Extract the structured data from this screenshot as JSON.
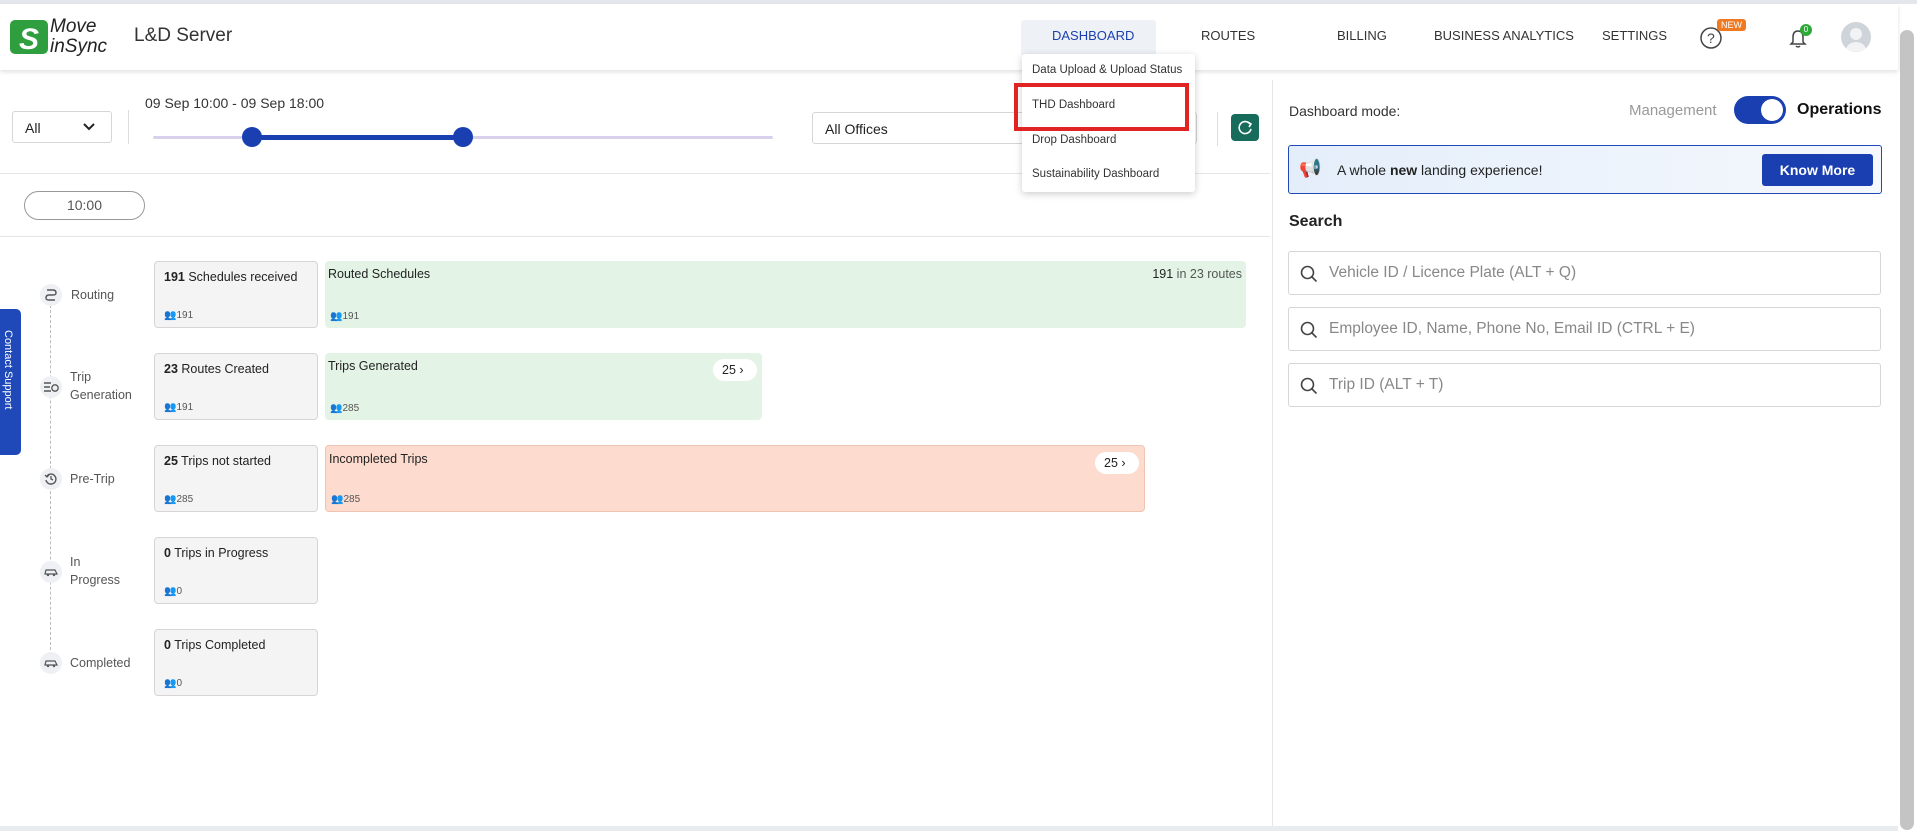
{
  "header": {
    "logo_line1": "Move",
    "logo_line2": "inSync",
    "app_title": "L&D Server",
    "nav": [
      "DASHBOARD",
      "ROUTES",
      "BILLING",
      "BUSINESS ANALYTICS",
      "SETTINGS"
    ],
    "new_badge": "NEW",
    "notification_count": "0"
  },
  "dropdown": {
    "items": [
      "Data Upload & Upload Status",
      "THD Dashboard",
      "Drop Dashboard",
      "Sustainability Dashboard"
    ]
  },
  "filters": {
    "shift_select": "All",
    "time_range": "09 Sep 10:00 - 09 Sep 18:00",
    "slider_start": 0.16,
    "slider_end": 0.5,
    "offices_select": "All Offices",
    "time_pill": "10:00"
  },
  "contact_support": "Contact Support",
  "stages": [
    {
      "label": "Routing",
      "icon": "routing-icon"
    },
    {
      "label": "Trip Generation",
      "icon": "trip-generation-icon"
    },
    {
      "label": "Pre-Trip",
      "icon": "pre-trip-icon"
    },
    {
      "label": "In Progress",
      "icon": "in-progress-icon"
    },
    {
      "label": "Completed",
      "icon": "completed-icon"
    }
  ],
  "cards": [
    {
      "num": "191",
      "text": "Schedules received",
      "count": "191"
    },
    {
      "num": "23",
      "text": "Routes Created",
      "count": "191"
    },
    {
      "num": "25",
      "text": "Trips not started",
      "count": "285"
    },
    {
      "num": "0",
      "text": "Trips in Progress",
      "count": "0"
    },
    {
      "num": "0",
      "text": "Trips Completed",
      "count": "0"
    }
  ],
  "wide_cards": [
    {
      "title": "Routed Schedules",
      "count": "191",
      "right_num": "191",
      "right_text": "in 23 routes"
    },
    {
      "title": "Trips Generated",
      "count": "285",
      "pill": "25"
    },
    {
      "title": "Incompleted Trips",
      "count": "285",
      "pill": "25"
    }
  ],
  "right_panel": {
    "mode_label": "Dashboard mode:",
    "mode_management": "Management",
    "mode_operations": "Operations",
    "banner_pre": "A whole ",
    "banner_bold": "new",
    "banner_post": " landing experience!",
    "know_more": "Know More",
    "search_title": "Search",
    "search_vehicle": "Vehicle ID / Licence Plate (ALT + Q)",
    "search_employee": "Employee ID, Name, Phone No, Email ID (CTRL + E)",
    "search_trip": "Trip ID (ALT + T)"
  },
  "colors": {
    "accent": "#1a3fb0",
    "green_card": "#e3f4e6",
    "salmon_card": "#fddccf",
    "highlight": "#e02424"
  }
}
